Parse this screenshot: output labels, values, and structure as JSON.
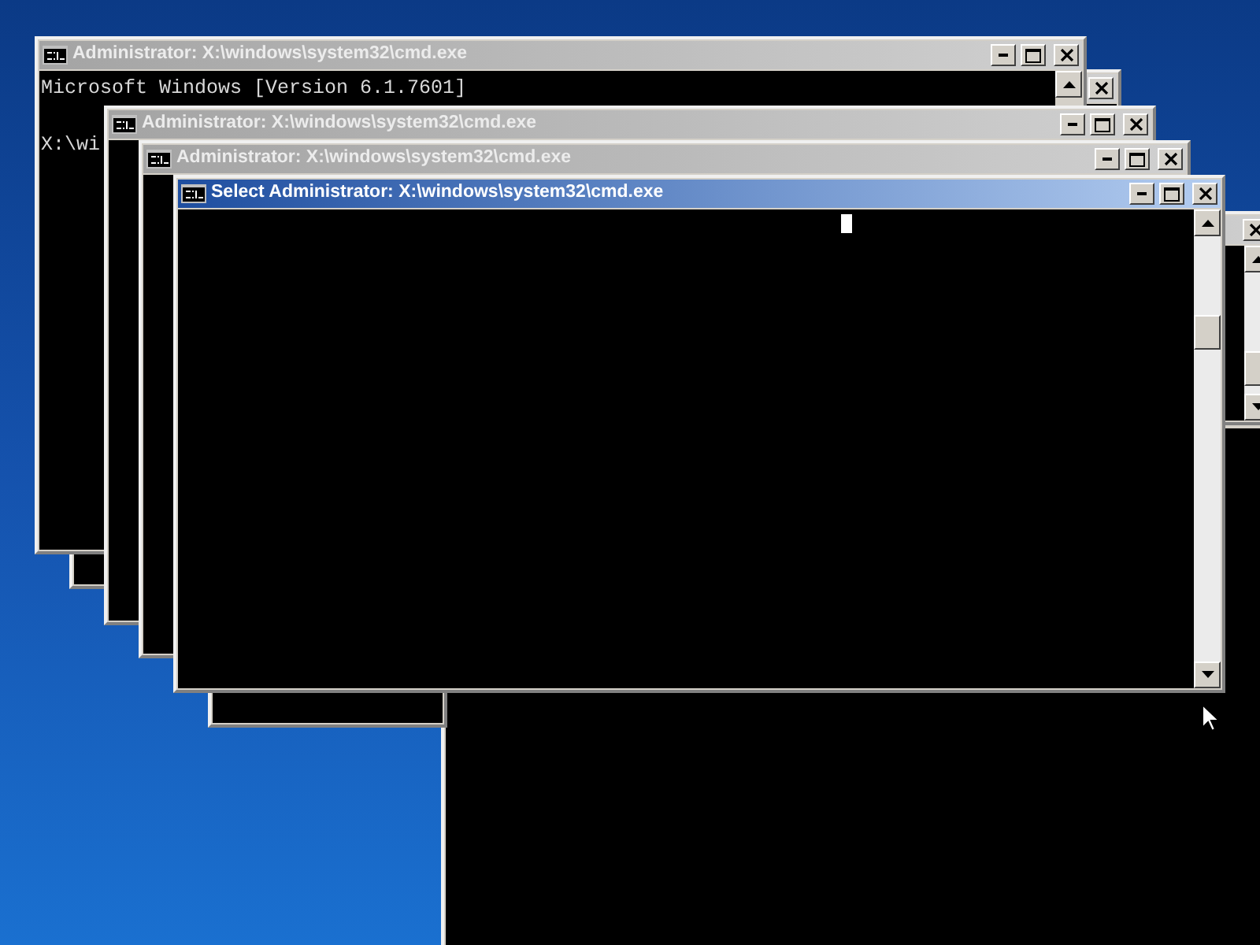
{
  "desktop": {
    "windows": [
      {
        "kind": "frame"
      },
      {
        "kind": "window",
        "selected": false
      },
      {
        "kind": "frame"
      },
      {
        "kind": "window",
        "selected": false
      },
      {
        "kind": "window",
        "title": "Administrator: X:\\windows\\system32\\cmd.exe",
        "selected": false,
        "lines": [
          "Microsoft Windows [Version 6.1.7601]",
          "X:\\wi"
        ]
      },
      {
        "kind": "window",
        "title": "Administrator: X:\\windows\\system32\\cmd.exe",
        "selected": false
      },
      {
        "kind": "window",
        "title": "Administrator: X:\\windows\\system32\\cmd.exe",
        "selected": false
      },
      {
        "kind": "window",
        "title": "Select Administrator: X:\\windows\\system32\\cmd.exe",
        "selected": true,
        "cursor": true
      }
    ]
  }
}
